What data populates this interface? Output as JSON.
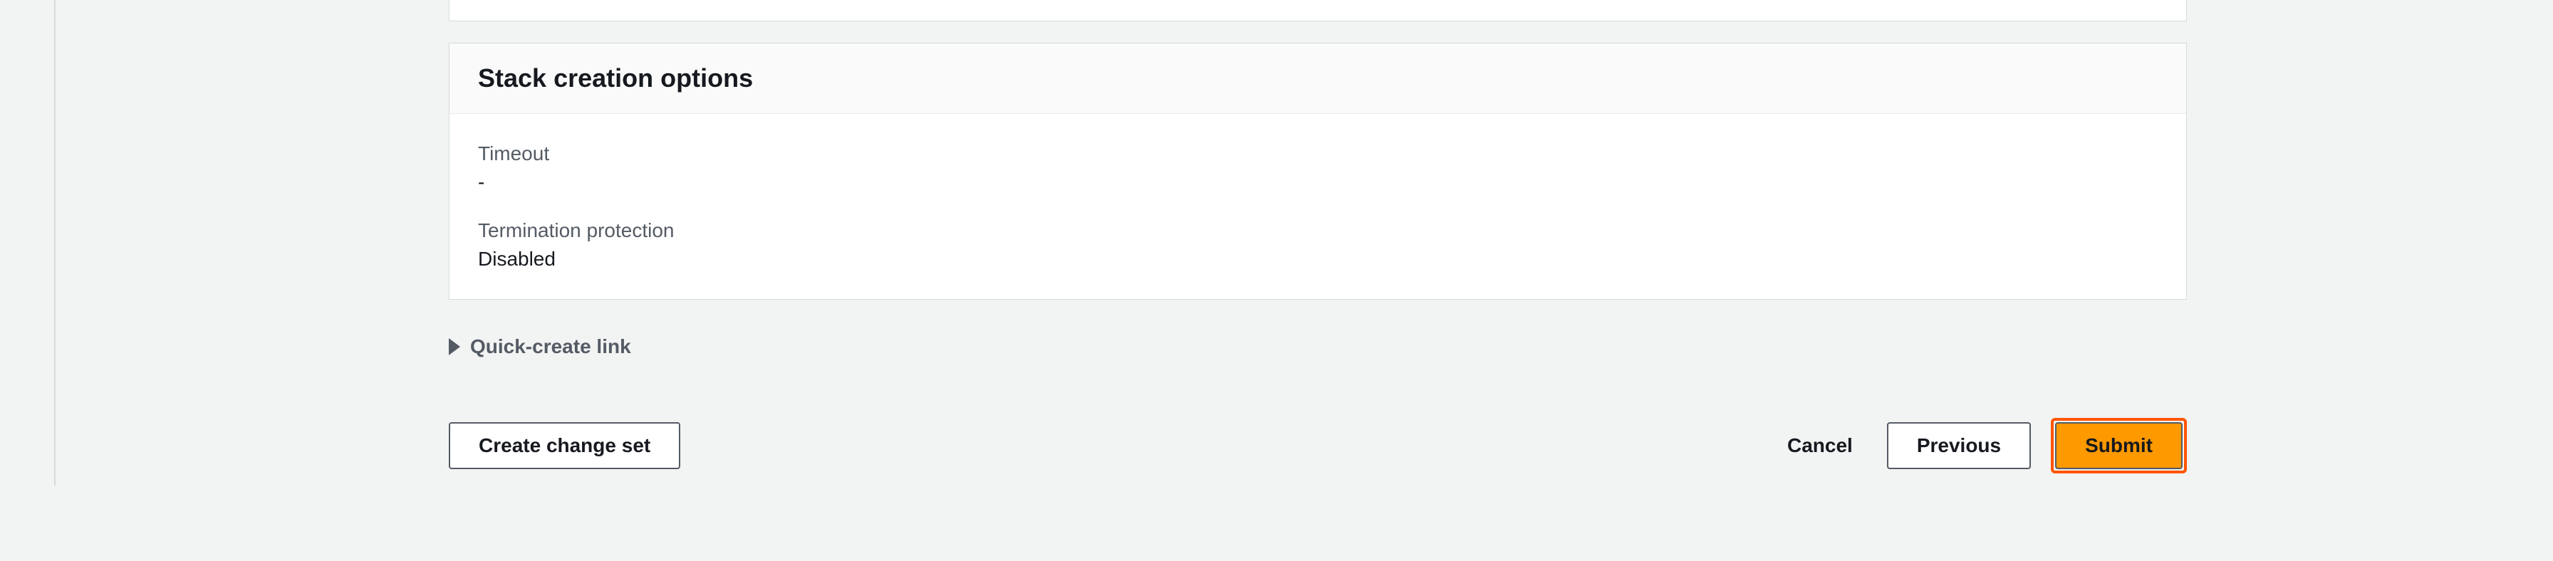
{
  "card": {
    "title": "Stack creation options",
    "fields": {
      "timeout": {
        "label": "Timeout",
        "value": "-"
      },
      "termination": {
        "label": "Termination protection",
        "value": "Disabled"
      }
    }
  },
  "expandable": {
    "label": "Quick-create link"
  },
  "buttons": {
    "create_change_set": "Create change set",
    "cancel": "Cancel",
    "previous": "Previous",
    "submit": "Submit"
  }
}
